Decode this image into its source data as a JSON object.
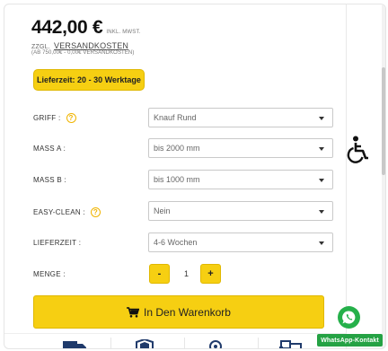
{
  "price": {
    "amount": "442,00 €",
    "note": "INKL. MWST."
  },
  "shipping": {
    "prefix": "ZZGL.",
    "link": "VERSANDKOSTEN",
    "sub": "(AB 750,00€ - 0,00€ VERSANDKOSTEN)"
  },
  "delivery_badge": "Lieferzeit: 20 - 30 Werktage",
  "options": [
    {
      "label": "GRIFF :",
      "help": "?",
      "value": "Knauf Rund"
    },
    {
      "label": "MASS A :",
      "value": "bis 2000 mm"
    },
    {
      "label": "MASS B :",
      "value": "bis 1000 mm"
    },
    {
      "label": "EASY-CLEAN :",
      "help": "?",
      "value": "Nein"
    },
    {
      "label": "LIEFERZEIT :",
      "value": "4-6 Wochen"
    }
  ],
  "quantity": {
    "label": "MENGE :",
    "minus": "-",
    "value": "1",
    "plus": "+"
  },
  "cart_button": "In Den Warenkorb",
  "whatsapp": {
    "label": "WhatsApp-Kontakt"
  },
  "colors": {
    "accent": "#f6cf12",
    "whatsapp": "#25b04a",
    "help": "#f0b400"
  },
  "icons": [
    "wheelchair-icon",
    "cart-icon",
    "truck-icon",
    "shield-icon",
    "support-icon",
    "delivery-icon",
    "whatsapp-icon"
  ]
}
